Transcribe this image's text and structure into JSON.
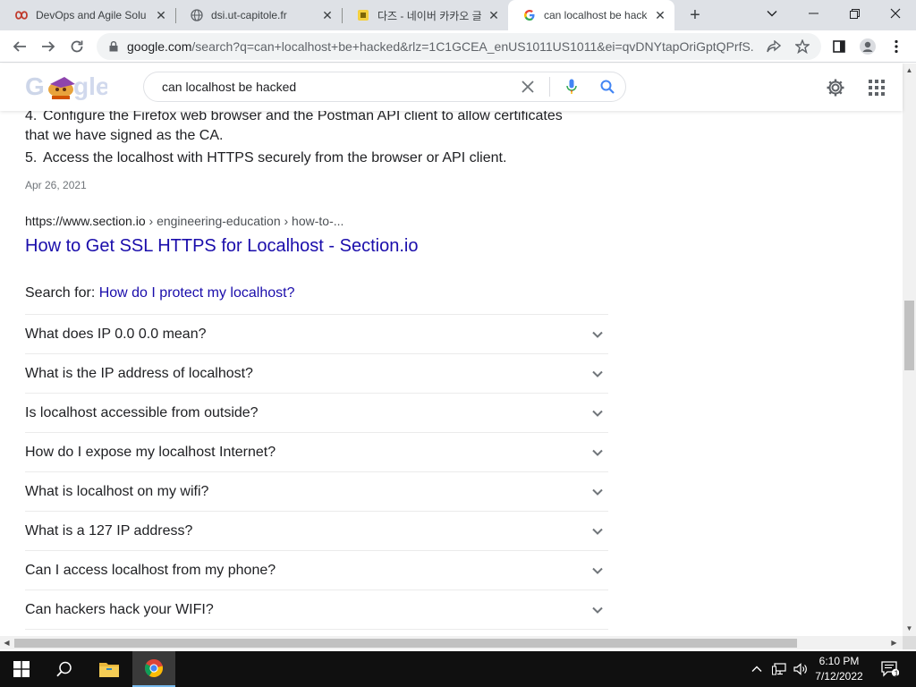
{
  "browser": {
    "tabs": [
      {
        "title": "DevOps and Agile Solu",
        "icon": "devops-favicon"
      },
      {
        "title": "dsi.ut-capitole.fr",
        "icon": "globe-icon"
      },
      {
        "title": "다즈 - 네이버 카카오 글",
        "icon": "naver-favicon"
      },
      {
        "title": "can localhost be hacke",
        "icon": "google-g-icon",
        "active": true
      }
    ],
    "address": {
      "host": "google.com",
      "path": "/search?q=can+localhost+be+hacked&rlz=1C1GCEA_enUS1011US1011&ei=qvDNYtapOriGptQPrfS..."
    }
  },
  "google": {
    "query": "can localhost be hacked",
    "logo_text": "Google"
  },
  "results": {
    "list_items": [
      {
        "num": "4.",
        "text": "Configure the Firefox web browser and the Postman API client to allow certificates that we have signed as the CA."
      },
      {
        "num": "5.",
        "text": "Access the localhost with HTTPS securely from the browser or API client."
      }
    ],
    "date": "Apr 26, 2021",
    "cite_host": "https://www.section.io",
    "cite_path": " › engineering-education › how-to-...",
    "title": "How to Get SSL HTTPS for Localhost - Section.io",
    "search_for_label": "Search for: ",
    "search_for_link": "How do I protect my localhost?"
  },
  "paa": [
    "What does IP 0.0 0.0 mean?",
    "What is the IP address of localhost?",
    "Is localhost accessible from outside?",
    "How do I expose my localhost Internet?",
    "What is localhost on my wifi?",
    "What is a 127 IP address?",
    "Can I access localhost from my phone?",
    "Can hackers hack your WIFI?"
  ],
  "taskbar": {
    "time": "6:10 PM",
    "date": "7/12/2022",
    "notification_count": "1"
  },
  "colors": {
    "link": "#1a0dab",
    "text": "#202124",
    "muted": "#70757a",
    "tabbar": "#dee1e6"
  }
}
